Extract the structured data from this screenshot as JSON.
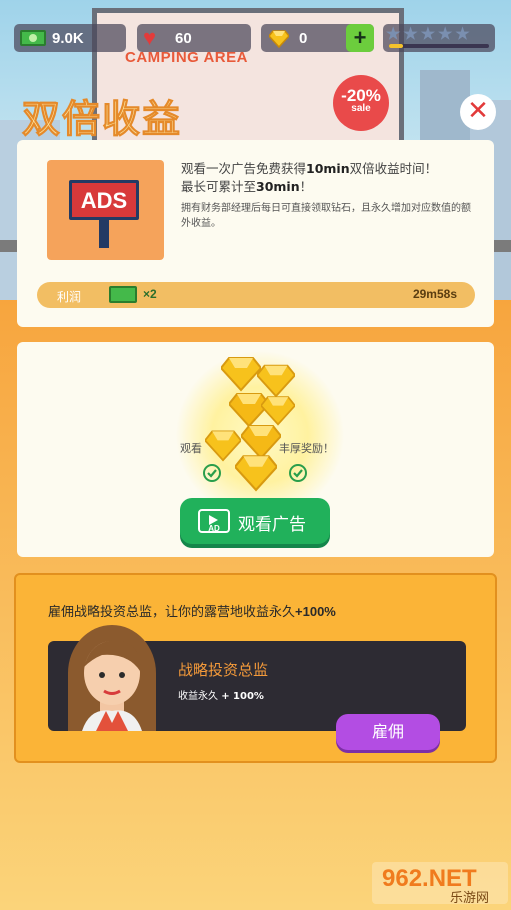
{
  "hud": {
    "cash": "9.0K",
    "hearts": "60",
    "gems": "0",
    "add_gems": "+",
    "rating_icons": [
      "star-icon",
      "star-icon",
      "star-icon",
      "star-icon",
      "star-icon"
    ],
    "rating_progress": 0.14
  },
  "background": {
    "billboard_text": "CAMPING AREA",
    "sale_percent": "-20%",
    "sale_word": "sale"
  },
  "title": "双倍收益",
  "close_symbol": "✕",
  "ads_card": {
    "ads_label": "ADS",
    "line1_pre": "观看一次广告免费获得",
    "line1_bold": "10min",
    "line1_post": "双倍收益时间！",
    "line2_pre": "最长可累计至",
    "line2_bold": "30min",
    "line2_post": "！",
    "note": "拥有财务部经理后每日可直接领取钻石，且永久增加对应数值的额外收益。",
    "profit_label": "利润",
    "multiplier": "×2",
    "timer": "29m58s"
  },
  "reward_card": {
    "text_left": "观看",
    "text_right": "丰厚奖励！",
    "watch_label": "观看广告",
    "ad_icon_label": "AD"
  },
  "manager_card": {
    "headline_pre": "雇佣战略投资总监，让你的露营地收益永久",
    "headline_bold": "+100%",
    "manager_name": "战略投资总监",
    "bonus_pre": "收益永久 ",
    "bonus_bold": "+ 100%",
    "hire_label": "雇佣"
  },
  "watermark": {
    "brand": "962.NET",
    "sub": "乐游网"
  }
}
